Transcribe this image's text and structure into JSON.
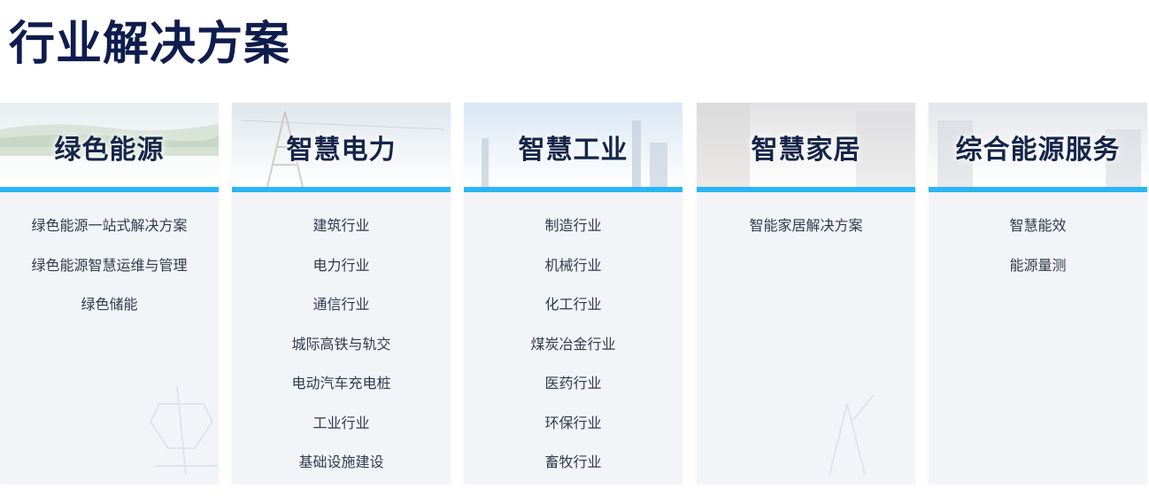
{
  "page": {
    "title": "行业解决方案"
  },
  "colors": {
    "accent": "#2ab6f4",
    "title": "#0f1c4d",
    "card_bg": "#f2f4f8"
  },
  "cards": [
    {
      "title": "绿色能源",
      "items": [
        "绿色能源一站式解决方案",
        "绿色能源智慧运维与管理",
        "绿色储能"
      ]
    },
    {
      "title": "智慧电力",
      "items": [
        "建筑行业",
        "电力行业",
        "通信行业",
        "城际高铁与轨交",
        "电动汽车充电桩",
        "工业行业",
        "基础设施建设"
      ]
    },
    {
      "title": "智慧工业",
      "items": [
        "制造行业",
        "机械行业",
        "化工行业",
        "煤炭冶金行业",
        "医药行业",
        "环保行业",
        "畜牧行业"
      ]
    },
    {
      "title": "智慧家居",
      "items": [
        "智能家居解决方案"
      ]
    },
    {
      "title": "综合能源服务",
      "items": [
        "智慧能效",
        "能源量测"
      ]
    }
  ]
}
